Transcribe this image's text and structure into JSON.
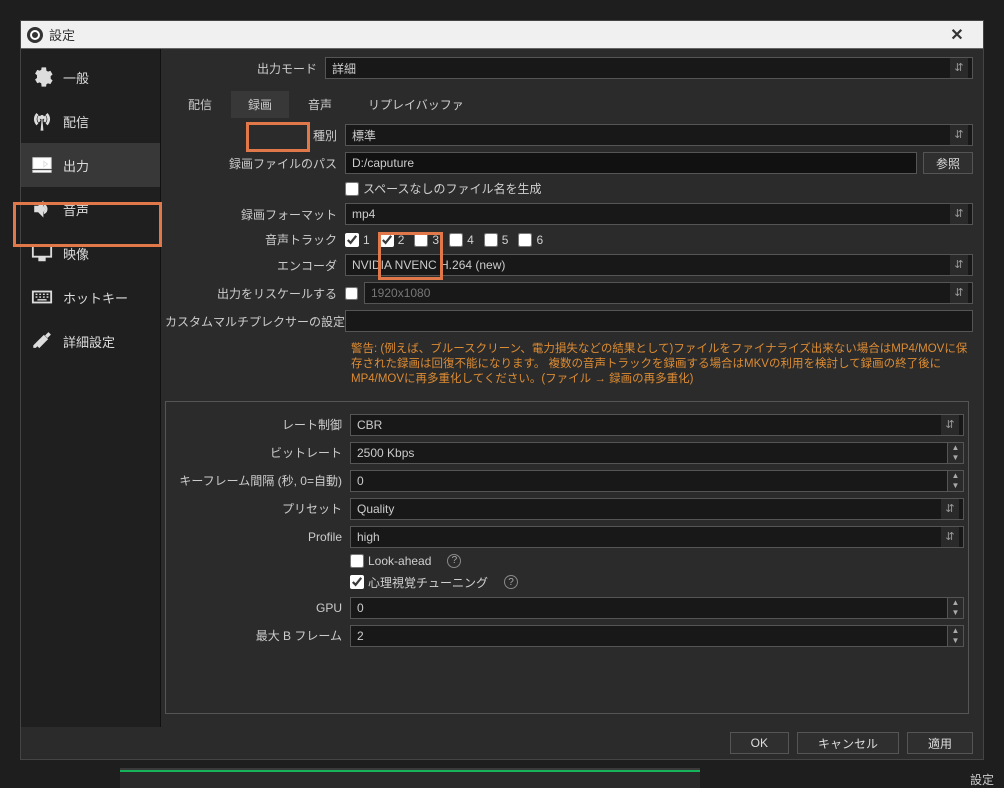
{
  "window": {
    "title": "設定"
  },
  "sidebar": {
    "items": [
      {
        "label": "一般"
      },
      {
        "label": "配信"
      },
      {
        "label": "出力"
      },
      {
        "label": "音声"
      },
      {
        "label": "映像"
      },
      {
        "label": "ホットキー"
      },
      {
        "label": "詳細設定"
      }
    ]
  },
  "header": {
    "output_mode_label": "出力モード",
    "output_mode_value": "詳細"
  },
  "tabs": {
    "stream": "配信",
    "record": "録画",
    "audio": "音声",
    "replay": "リプレイバッファ"
  },
  "recording": {
    "type_label": "種別",
    "type_value": "標準",
    "path_label": "録画ファイルのパス",
    "path_value": "D:/caputure",
    "browse": "参照",
    "nospace_label": "スペースなしのファイル名を生成",
    "format_label": "録画フォーマット",
    "format_value": "mp4",
    "tracks_label": "音声トラック",
    "track_labels": [
      "1",
      "2",
      "3",
      "4",
      "5",
      "6"
    ],
    "encoder_label": "エンコーダ",
    "encoder_value": "NVIDIA NVENC H.264 (new)",
    "rescale_label": "出力をリスケールする",
    "rescale_placeholder": "1920x1080",
    "muxer_label": "カスタムマルチプレクサーの設定",
    "warning": "警告: (例えば、ブルースクリーン、電力損失などの結果として)ファイルをファイナライズ出来ない場合はMP4/MOVに保存された録画は回復不能になります。 複数の音声トラックを録画する場合はMKVの利用を検討して録画の終了後にMP4/MOVに再多重化してください。(ファイル → 録画の再多重化)"
  },
  "encoder": {
    "rate_control_label": "レート制御",
    "rate_control_value": "CBR",
    "bitrate_label": "ビットレート",
    "bitrate_value": "2500 Kbps",
    "keyframe_label": "キーフレーム間隔 (秒, 0=自動)",
    "keyframe_value": "0",
    "preset_label": "プリセット",
    "preset_value": "Quality",
    "profile_label": "Profile",
    "profile_value": "high",
    "lookahead_label": "Look-ahead",
    "psycho_label": "心理視覚チューニング",
    "gpu_label": "GPU",
    "gpu_value": "0",
    "bframes_label": "最大 B フレーム",
    "bframes_value": "2"
  },
  "footer": {
    "ok": "OK",
    "cancel": "キャンセル",
    "apply": "適用"
  },
  "bg": {
    "settings_text": "設定"
  }
}
